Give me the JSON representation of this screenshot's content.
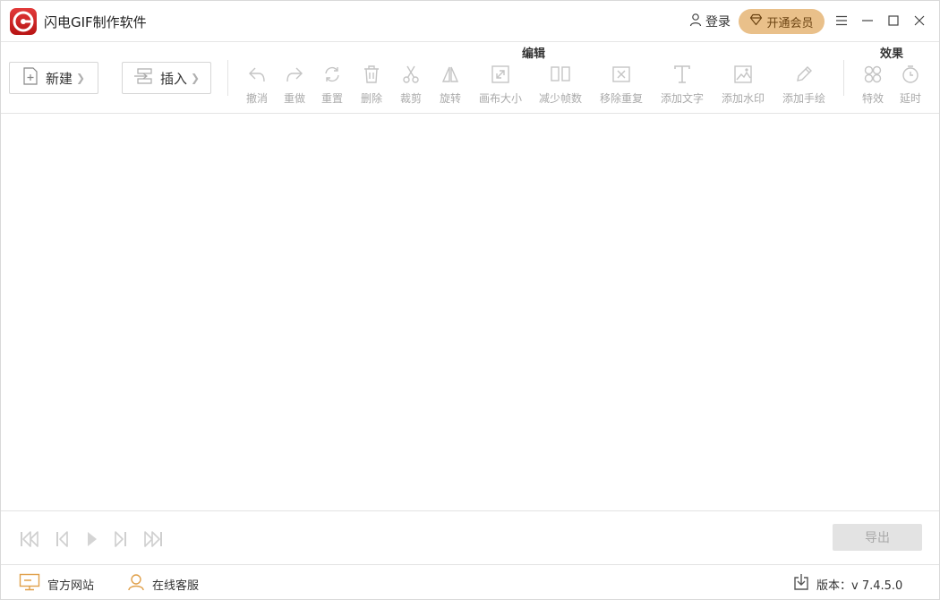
{
  "app": {
    "title": "闪电GIF制作软件"
  },
  "header": {
    "login_label": "登录",
    "vip_label": "开通会员",
    "accent_color": "#e9c08a"
  },
  "toolbar": {
    "new_label": "新建",
    "insert_label": "插入",
    "edit_group_label": "编辑",
    "effect_group_label": "效果",
    "tools": [
      {
        "label": "撤消",
        "icon": "undo-icon"
      },
      {
        "label": "重做",
        "icon": "redo-icon"
      },
      {
        "label": "重置",
        "icon": "reset-icon"
      },
      {
        "label": "删除",
        "icon": "trash-icon"
      },
      {
        "label": "裁剪",
        "icon": "scissors-icon"
      },
      {
        "label": "旋转",
        "icon": "flip-icon"
      },
      {
        "label": "画布大小",
        "icon": "resize-icon"
      },
      {
        "label": "减少帧数",
        "icon": "frames-icon"
      },
      {
        "label": "移除重复",
        "icon": "remove-duplicate-icon"
      },
      {
        "label": "添加文字",
        "icon": "text-icon"
      },
      {
        "label": "添加水印",
        "icon": "watermark-icon"
      },
      {
        "label": "添加手绘",
        "icon": "pencil-icon"
      }
    ],
    "effects": [
      {
        "label": "特效",
        "icon": "effects-icon"
      },
      {
        "label": "延时",
        "icon": "timer-icon"
      }
    ]
  },
  "player": {
    "export_label": "导出"
  },
  "statusbar": {
    "website_label": "官方网站",
    "support_label": "在线客服",
    "version_label": "版本：v 7.4.5.0"
  }
}
